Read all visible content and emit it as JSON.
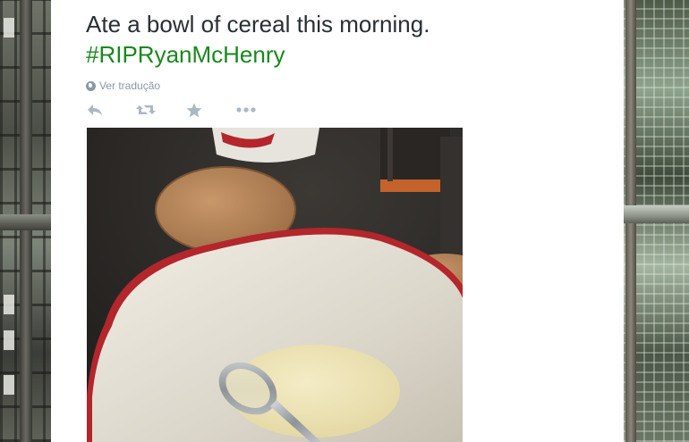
{
  "tweet": {
    "text": "Ate a bowl of cereal this morning.",
    "hashtag": "#RIPRyanMcHenry",
    "translate_label": "Ver tradução",
    "hashtag_color": "#19891e",
    "text_color": "#292f33"
  },
  "actions": [
    {
      "name": "reply-button",
      "icon": "reply-icon"
    },
    {
      "name": "retweet-button",
      "icon": "retweet-icon"
    },
    {
      "name": "favorite-button",
      "icon": "star-icon"
    },
    {
      "name": "more-button",
      "icon": "more-icon"
    }
  ],
  "photo": {
    "subject": "bowl-with-milk-and-spoon"
  }
}
